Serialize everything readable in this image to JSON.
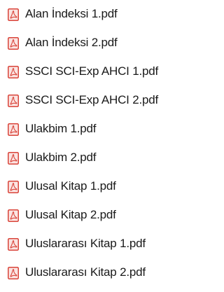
{
  "file_list": {
    "icon": "pdf-file-icon",
    "icon_color": "#d9443a",
    "items": [
      {
        "name": "Alan İndeksi 1.pdf"
      },
      {
        "name": "Alan İndeksi 2.pdf"
      },
      {
        "name": "SSCI SCI-Exp AHCI 1.pdf"
      },
      {
        "name": "SSCI SCI-Exp AHCI 2.pdf"
      },
      {
        "name": "Ulakbim 1.pdf"
      },
      {
        "name": "Ulakbim 2.pdf"
      },
      {
        "name": "Ulusal Kitap 1.pdf"
      },
      {
        "name": "Ulusal Kitap 2.pdf"
      },
      {
        "name": "Uluslararası Kitap 1.pdf"
      },
      {
        "name": "Uluslararası Kitap 2.pdf"
      }
    ]
  }
}
